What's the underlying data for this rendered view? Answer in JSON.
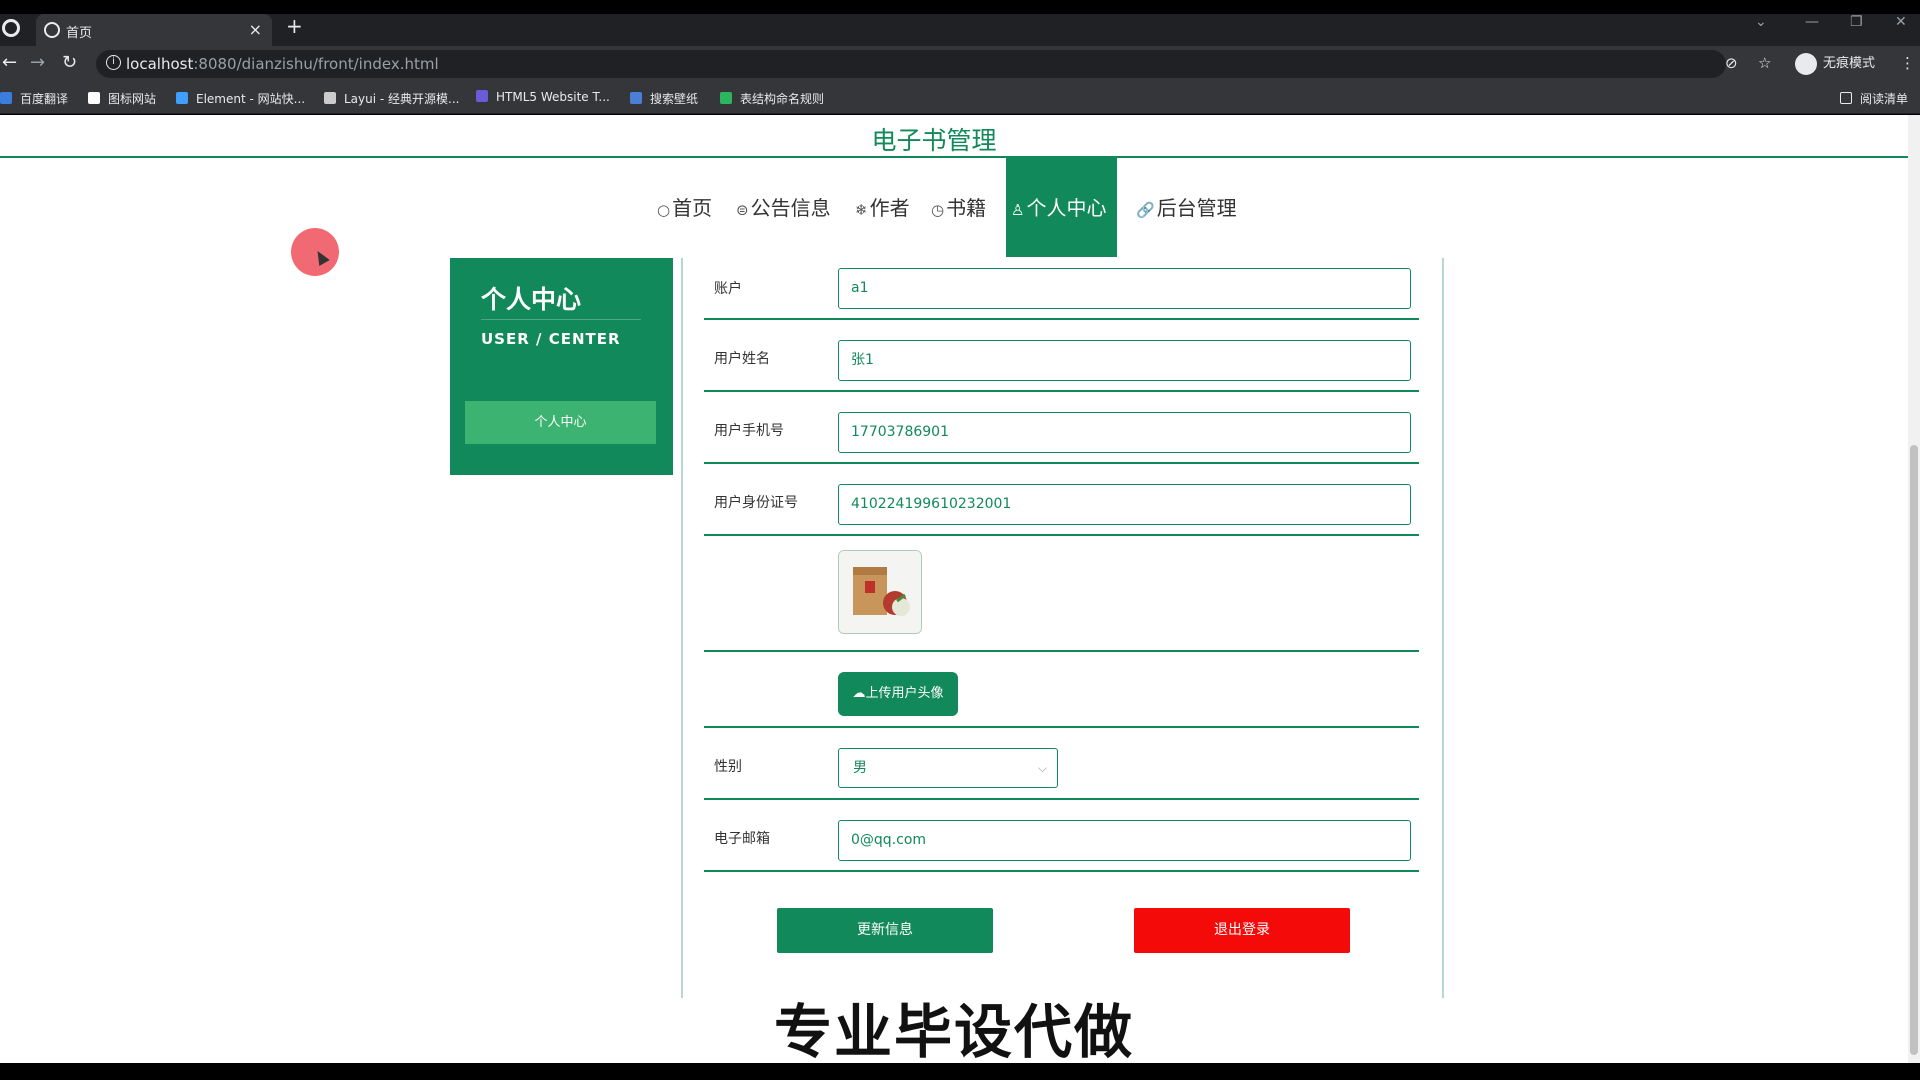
{
  "browser": {
    "tab_title": "首页",
    "tab_close": "×",
    "new_tab": "+",
    "url_host": "localhost",
    "url_path": ":8080/dianzishu/front/index.html",
    "incognito_label": "无痕模式",
    "reading_list": "阅读清单",
    "bookmarks": [
      {
        "label": "百度翻译",
        "color": "#3b7ddd"
      },
      {
        "label": "图标网站",
        "color": "#ffffff"
      },
      {
        "label": "Element - 网站快...",
        "color": "#409eff"
      },
      {
        "label": "Layui - 经典开源模...",
        "color": "#cccccc"
      },
      {
        "label": "HTML5 Website T...",
        "color": "#6b5bd6"
      },
      {
        "label": "搜索壁纸",
        "color": "#4a7fd8"
      },
      {
        "label": "表结构命名规则",
        "color": "#2db55d"
      }
    ]
  },
  "site": {
    "title": "电子书管理",
    "accent": "#12895a",
    "nav": [
      {
        "icon": "○",
        "label": "首页"
      },
      {
        "icon": "⊜",
        "label": "公告信息"
      },
      {
        "icon": "❄",
        "label": "作者"
      },
      {
        "icon": "◷",
        "label": "书籍"
      },
      {
        "icon": "♙",
        "label": "个人中心",
        "active": true
      },
      {
        "icon": "🔗",
        "label": "后台管理"
      }
    ]
  },
  "sidebar": {
    "title": "个人中心",
    "subtitle": "USER / CENTER",
    "button": "个人中心"
  },
  "form": {
    "account_label": "账户",
    "account_value": "a1",
    "name_label": "用户姓名",
    "name_value": "张1",
    "phone_label": "用户手机号",
    "phone_value": "17703786901",
    "idcard_label": "用户身份证号",
    "idcard_value": "410224199610232001",
    "upload_button": "上传用户头像",
    "gender_label": "性别",
    "gender_value": "男",
    "email_label": "电子邮箱",
    "email_value": "0@qq.com",
    "update_button": "更新信息",
    "logout_button": "退出登录"
  },
  "watermark": "专业毕设代做"
}
